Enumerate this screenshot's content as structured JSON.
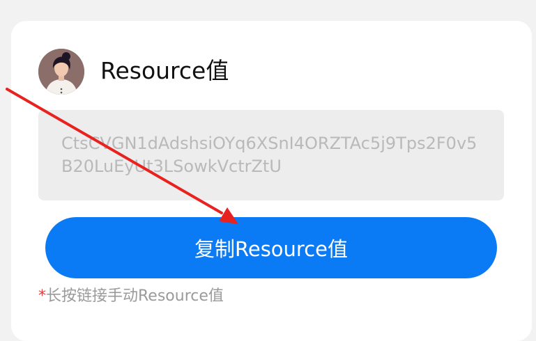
{
  "header": {
    "title": "Resource值",
    "avatar_icon": "user-avatar-icon"
  },
  "token": {
    "value": "CtsCVGN1dAdshsiOYq6XSnI4ORZTAc5j9Tps2F0v5B20LuEyUt3LSowkVctrZtU"
  },
  "actions": {
    "copy_label": "复制Resource值"
  },
  "hint": {
    "star": "*",
    "text": "长按链接手动Resource值"
  },
  "colors": {
    "accent": "#0a7bf5",
    "required_star": "#e53935",
    "annotation_arrow": "#e8231f"
  }
}
